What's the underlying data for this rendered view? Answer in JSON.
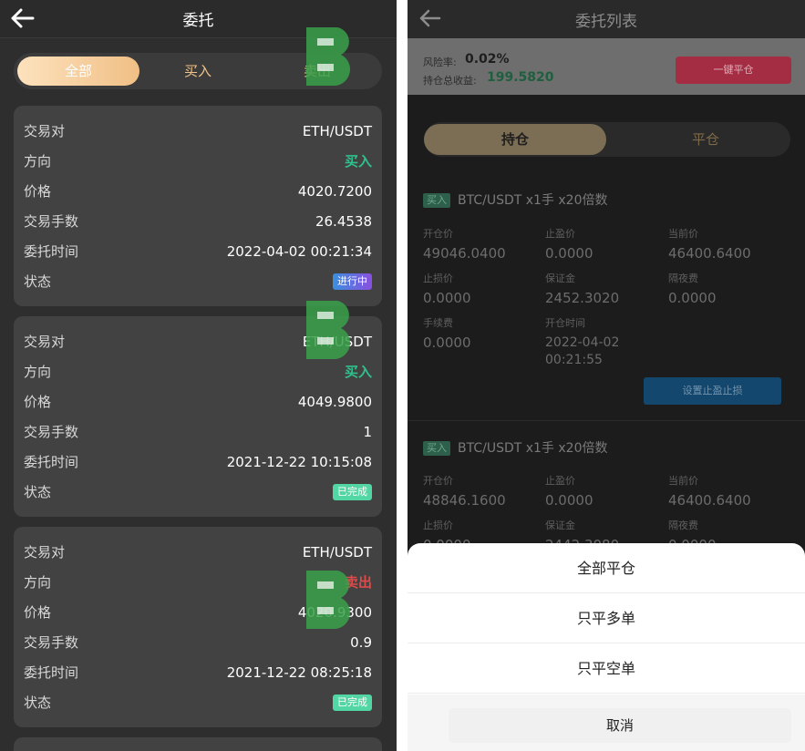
{
  "left": {
    "title": "委托",
    "tabs": [
      {
        "label": "全部",
        "active": true
      },
      {
        "label": "买入",
        "active": false
      },
      {
        "label": "卖出",
        "active": false
      }
    ],
    "field_labels": {
      "pair": "交易对",
      "direction": "方向",
      "price": "价格",
      "volume": "交易手数",
      "time": "委托时间",
      "status": "状态"
    },
    "orders": [
      {
        "pair": "ETH/USDT",
        "direction": "买入",
        "direction_type": "buy",
        "price": "4020.7200",
        "volume": "26.4538",
        "time": "2022-04-02 00:21:34",
        "status": "进行中",
        "status_type": "run"
      },
      {
        "pair": "ETH/USDT",
        "direction": "买入",
        "direction_type": "buy",
        "price": "4049.9800",
        "volume": "1",
        "time": "2021-12-22 10:15:08",
        "status": "已完成",
        "status_type": "done"
      },
      {
        "pair": "ETH/USDT",
        "direction": "卖出",
        "direction_type": "sell",
        "price": "4020.9300",
        "volume": "0.9",
        "time": "2021-12-22 08:25:18",
        "status": "已完成",
        "status_type": "done"
      }
    ]
  },
  "right": {
    "title": "委托列表",
    "risk_label": "风险率:",
    "risk_value": "0.02%",
    "pnl_label": "持仓总收益:",
    "pnl_value": "199.5820",
    "close_all_label": "一键平仓",
    "tabs": [
      {
        "label": "持仓",
        "active": true
      },
      {
        "label": "平仓",
        "active": false
      }
    ],
    "field_labels": {
      "open_price": "开仓价",
      "take_profit": "止盈价",
      "current_price": "当前价",
      "stop_loss": "止损价",
      "margin": "保证金",
      "overnight_fee": "隔夜费",
      "fee": "手续费",
      "open_time": "开仓时间"
    },
    "set_tp_sl_label": "设置止盈止损",
    "positions": [
      {
        "side": "买入",
        "pair": "BTC/USDT x1手 x20倍数",
        "open_price": "49046.0400",
        "take_profit": "0.0000",
        "current_price": "46400.6400",
        "stop_loss": "0.0000",
        "margin": "2452.3020",
        "overnight_fee": "0.0000",
        "fee": "0.0000",
        "open_time_date": "2022-04-02",
        "open_time_clock": "00:21:55"
      },
      {
        "side": "买入",
        "pair": "BTC/USDT x1手 x20倍数",
        "open_price": "48846.1600",
        "take_profit": "0.0000",
        "current_price": "46400.6400",
        "stop_loss": "0.0000",
        "margin": "2442.3080",
        "overnight_fee": "0.0000"
      }
    ],
    "sheet": {
      "items": [
        "全部平仓",
        "只平多单",
        "只平空单"
      ],
      "cancel": "取消"
    }
  },
  "colors": {
    "buy": "#2fc18d",
    "sell": "#e04a4a",
    "accent_gold": "#f0bf85",
    "danger_button": "#a42d43"
  },
  "icons": {
    "back": "arrow-left-icon",
    "watermark": "watermark-logo-icon"
  }
}
